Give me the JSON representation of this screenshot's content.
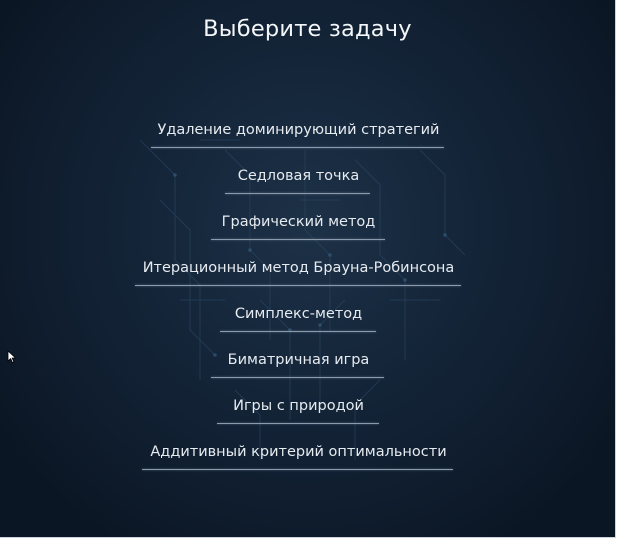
{
  "title": "Выберите задачу",
  "menu": [
    {
      "label": "Удаление доминирующий стратегий"
    },
    {
      "label": "Седловая точка"
    },
    {
      "label": "Графический метод"
    },
    {
      "label": "Итерационный метод Брауна-Робинсона"
    },
    {
      "label": "Симплекс-метод"
    },
    {
      "label": "Биматричная игра"
    },
    {
      "label": "Игры с природой"
    },
    {
      "label": "Аддитивный критерий оптимальности"
    }
  ],
  "icons": {
    "cursor": "mouse-pointer-icon"
  },
  "colors": {
    "background": "#15263a",
    "text": "#e6ebf0",
    "underline": "#8c9bab"
  }
}
